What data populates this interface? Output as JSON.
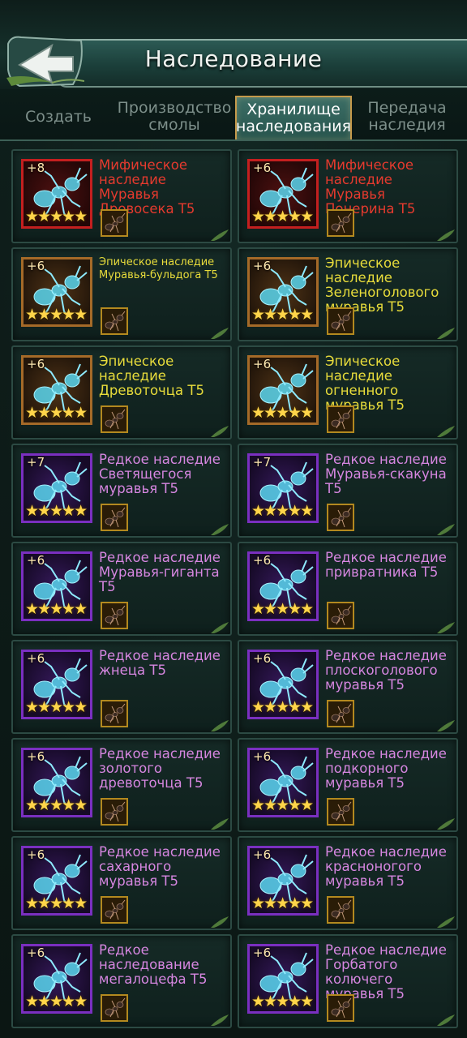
{
  "header": {
    "title": "Наследование"
  },
  "tabs": [
    {
      "label": "Создать",
      "active": false
    },
    {
      "label": "Производство смолы",
      "active": false
    },
    {
      "label": "Хранилище наследования",
      "active": true
    },
    {
      "label": "Передача наследия",
      "active": false
    }
  ],
  "cards": [
    {
      "level": "+8",
      "stars": "★★★★★",
      "name": "Мифическое наследие Муравья Дровосека Т5",
      "rarity": "mythic"
    },
    {
      "level": "+6",
      "stars": "★★★★★",
      "name": "Мифическое наследие Муравья Понерина Т5",
      "rarity": "mythic"
    },
    {
      "level": "+6",
      "stars": "★★★★★",
      "name": "Эпическое наследие Муравья-бульдога Т5",
      "rarity": "epic"
    },
    {
      "level": "+6",
      "stars": "★★★★★",
      "name": "Эпическое наследие Зеленоголового муравья Т5",
      "rarity": "epic"
    },
    {
      "level": "+6",
      "stars": "★★★★★",
      "name": "Эпическое наследие Древоточца Т5",
      "rarity": "epic"
    },
    {
      "level": "+6",
      "stars": "★★★★★",
      "name": "Эпическое наследие огненного муравья Т5",
      "rarity": "epic"
    },
    {
      "level": "+7",
      "stars": "★★★★★",
      "name": "Редкое наследие Светящегося муравья Т5",
      "rarity": "rare"
    },
    {
      "level": "+7",
      "stars": "★★★★★",
      "name": "Редкое наследие Муравья-скакуна Т5",
      "rarity": "rare"
    },
    {
      "level": "+6",
      "stars": "★★★★★",
      "name": "Редкое наследие Муравья-гиганта Т5",
      "rarity": "rare"
    },
    {
      "level": "+6",
      "stars": "★★★★★",
      "name": "Редкое наследие привратника Т5",
      "rarity": "rare"
    },
    {
      "level": "+6",
      "stars": "★★★★★",
      "name": "Редкое наследие жнеца Т5",
      "rarity": "rare"
    },
    {
      "level": "+6",
      "stars": "★★★★★",
      "name": "Редкое наследие плоскоголового муравья Т5",
      "rarity": "rare"
    },
    {
      "level": "+6",
      "stars": "★★★★★",
      "name": "Редкое наследие золотого древоточца Т5",
      "rarity": "rare"
    },
    {
      "level": "+6",
      "stars": "★★★★★",
      "name": "Редкое наследие подкорного муравья Т5",
      "rarity": "rare"
    },
    {
      "level": "+6",
      "stars": "★★★★★",
      "name": "Редкое наследие сахарного муравья Т5",
      "rarity": "rare"
    },
    {
      "level": "+6",
      "stars": "★★★★★",
      "name": "Редкое наследие красноногого муравья Т5",
      "rarity": "rare"
    },
    {
      "level": "+6",
      "stars": "★★★★★",
      "name": "Редкое наследование мегалоцефа Т5",
      "rarity": "rare"
    },
    {
      "level": "+6",
      "stars": "★★★★★",
      "name": "Редкое наследие Горбатого колючего муравья Т5",
      "rarity": "rare"
    }
  ]
}
